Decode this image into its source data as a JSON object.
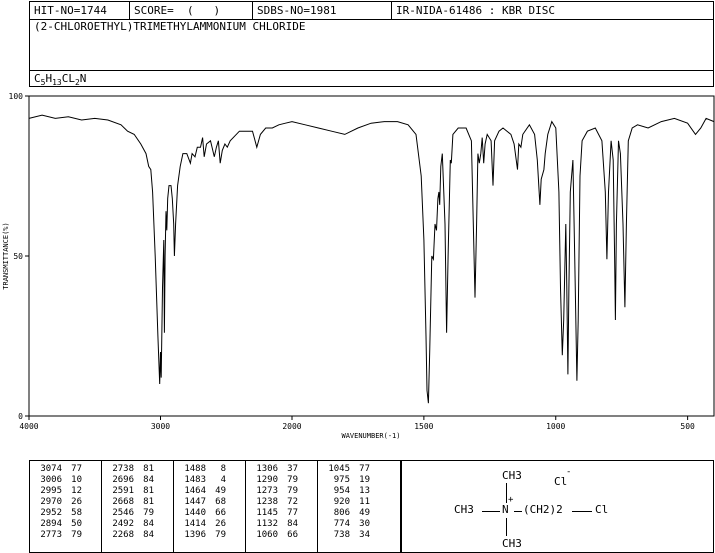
{
  "header": {
    "hit_no": "HIT-NO=1744",
    "score": "SCORE=  (   )",
    "sdbs_no": "SDBS-NO=1981",
    "ir_id": "IR-NIDA-61486 : KBR DISC",
    "compound_name": "(2-CHLOROETHYL)TRIMETHYLAMMONIUM CHLORIDE",
    "formula_parts": {
      "c": "C",
      "c_n": "5",
      "h": "H",
      "h_n": "13",
      "cl": "CL",
      "cl_n": "2",
      "n": "N"
    }
  },
  "chart_data": {
    "type": "line",
    "xlabel": "WAVENUMBER(-1)",
    "ylabel": "TRANSMITTANCE(%)",
    "xlim": [
      4000,
      400
    ],
    "ylim": [
      0,
      100
    ],
    "x_ticks": [
      4000,
      3000,
      2000,
      1500,
      1000,
      500
    ],
    "x_tick_labels": [
      "4000",
      "3000",
      "2000",
      "1500",
      "1000",
      "500"
    ],
    "y_ticks": [
      0,
      50,
      100
    ],
    "y_tick_labels": [
      "0",
      "50",
      "100"
    ],
    "series": [
      {
        "points": [
          [
            4000,
            93
          ],
          [
            3900,
            94
          ],
          [
            3800,
            93
          ],
          [
            3700,
            93.5
          ],
          [
            3600,
            92.5
          ],
          [
            3500,
            93
          ],
          [
            3400,
            92.5
          ],
          [
            3300,
            91
          ],
          [
            3250,
            89
          ],
          [
            3200,
            88
          ],
          [
            3150,
            85
          ],
          [
            3110,
            82
          ],
          [
            3090,
            78
          ],
          [
            3074,
            77
          ],
          [
            3060,
            70
          ],
          [
            3040,
            50
          ],
          [
            3020,
            25
          ],
          [
            3006,
            10
          ],
          [
            3000,
            20
          ],
          [
            2995,
            12
          ],
          [
            2985,
            40
          ],
          [
            2975,
            55
          ],
          [
            2970,
            26
          ],
          [
            2965,
            50
          ],
          [
            2958,
            64
          ],
          [
            2952,
            58
          ],
          [
            2945,
            68
          ],
          [
            2935,
            72
          ],
          [
            2920,
            72
          ],
          [
            2910,
            68
          ],
          [
            2900,
            60
          ],
          [
            2894,
            50
          ],
          [
            2885,
            60
          ],
          [
            2870,
            72
          ],
          [
            2850,
            78
          ],
          [
            2830,
            82
          ],
          [
            2800,
            82
          ],
          [
            2773,
            79
          ],
          [
            2760,
            82
          ],
          [
            2738,
            81
          ],
          [
            2720,
            84
          ],
          [
            2696,
            84
          ],
          [
            2680,
            87
          ],
          [
            2668,
            81
          ],
          [
            2650,
            85
          ],
          [
            2620,
            86
          ],
          [
            2591,
            81
          ],
          [
            2575,
            84
          ],
          [
            2560,
            86
          ],
          [
            2546,
            79
          ],
          [
            2530,
            83
          ],
          [
            2510,
            85
          ],
          [
            2492,
            84
          ],
          [
            2470,
            86
          ],
          [
            2400,
            89
          ],
          [
            2300,
            89
          ],
          [
            2268,
            84
          ],
          [
            2240,
            88
          ],
          [
            2200,
            90
          ],
          [
            2150,
            90
          ],
          [
            2100,
            91
          ],
          [
            2050,
            91.5
          ],
          [
            2000,
            92
          ],
          [
            1950,
            91
          ],
          [
            1900,
            90
          ],
          [
            1850,
            89
          ],
          [
            1800,
            88
          ],
          [
            1750,
            90
          ],
          [
            1700,
            91.5
          ],
          [
            1650,
            92
          ],
          [
            1600,
            92
          ],
          [
            1560,
            91
          ],
          [
            1530,
            88
          ],
          [
            1510,
            75
          ],
          [
            1500,
            55
          ],
          [
            1492,
            25
          ],
          [
            1488,
            8
          ],
          [
            1483,
            4
          ],
          [
            1478,
            20
          ],
          [
            1470,
            50
          ],
          [
            1464,
            49
          ],
          [
            1458,
            60
          ],
          [
            1452,
            58
          ],
          [
            1447,
            68
          ],
          [
            1443,
            70
          ],
          [
            1440,
            66
          ],
          [
            1436,
            78
          ],
          [
            1430,
            82
          ],
          [
            1420,
            60
          ],
          [
            1414,
            26
          ],
          [
            1408,
            50
          ],
          [
            1400,
            80
          ],
          [
            1396,
            79
          ],
          [
            1390,
            88
          ],
          [
            1370,
            90
          ],
          [
            1340,
            90
          ],
          [
            1320,
            86
          ],
          [
            1306,
            37
          ],
          [
            1300,
            60
          ],
          [
            1295,
            82
          ],
          [
            1290,
            79
          ],
          [
            1284,
            82
          ],
          [
            1279,
            87
          ],
          [
            1273,
            79
          ],
          [
            1268,
            85
          ],
          [
            1260,
            88
          ],
          [
            1245,
            86
          ],
          [
            1238,
            72
          ],
          [
            1232,
            86
          ],
          [
            1215,
            89
          ],
          [
            1200,
            90
          ],
          [
            1170,
            88
          ],
          [
            1158,
            85
          ],
          [
            1145,
            77
          ],
          [
            1140,
            85
          ],
          [
            1132,
            84
          ],
          [
            1125,
            88
          ],
          [
            1100,
            91
          ],
          [
            1080,
            88
          ],
          [
            1070,
            80
          ],
          [
            1060,
            66
          ],
          [
            1055,
            74
          ],
          [
            1045,
            77
          ],
          [
            1040,
            82
          ],
          [
            1030,
            88
          ],
          [
            1015,
            92
          ],
          [
            1000,
            90
          ],
          [
            988,
            70
          ],
          [
            982,
            40
          ],
          [
            975,
            19
          ],
          [
            970,
            30
          ],
          [
            962,
            60
          ],
          [
            958,
            40
          ],
          [
            954,
            13
          ],
          [
            950,
            40
          ],
          [
            945,
            70
          ],
          [
            935,
            80
          ],
          [
            928,
            50
          ],
          [
            920,
            11
          ],
          [
            915,
            30
          ],
          [
            908,
            75
          ],
          [
            900,
            86
          ],
          [
            880,
            89
          ],
          [
            850,
            90
          ],
          [
            825,
            86
          ],
          [
            812,
            70
          ],
          [
            806,
            49
          ],
          [
            800,
            70
          ],
          [
            790,
            86
          ],
          [
            782,
            80
          ],
          [
            777,
            50
          ],
          [
            774,
            30
          ],
          [
            770,
            60
          ],
          [
            762,
            86
          ],
          [
            755,
            82
          ],
          [
            745,
            60
          ],
          [
            738,
            34
          ],
          [
            732,
            60
          ],
          [
            725,
            86
          ],
          [
            710,
            90
          ],
          [
            690,
            91
          ],
          [
            650,
            90
          ],
          [
            600,
            92
          ],
          [
            550,
            93
          ],
          [
            500,
            91.5
          ],
          [
            470,
            88
          ],
          [
            450,
            90
          ],
          [
            430,
            93
          ],
          [
            400,
            92
          ]
        ]
      }
    ]
  },
  "peaks": {
    "columns": [
      [
        [
          "3074",
          "77"
        ],
        [
          "3006",
          "10"
        ],
        [
          "2995",
          "12"
        ],
        [
          "2970",
          "26"
        ],
        [
          "2952",
          "58"
        ],
        [
          "2894",
          "50"
        ],
        [
          "2773",
          "79"
        ]
      ],
      [
        [
          "2738",
          "81"
        ],
        [
          "2696",
          "84"
        ],
        [
          "2591",
          "81"
        ],
        [
          "2668",
          "81"
        ],
        [
          "2546",
          "79"
        ],
        [
          "2492",
          "84"
        ],
        [
          "2268",
          "84"
        ]
      ],
      [
        [
          "1488",
          "8"
        ],
        [
          "1483",
          "4"
        ],
        [
          "1464",
          "49"
        ],
        [
          "1447",
          "68"
        ],
        [
          "1440",
          "66"
        ],
        [
          "1414",
          "26"
        ],
        [
          "1396",
          "79"
        ]
      ],
      [
        [
          "1306",
          "37"
        ],
        [
          "1290",
          "79"
        ],
        [
          "1273",
          "79"
        ],
        [
          "1238",
          "72"
        ],
        [
          "1145",
          "77"
        ],
        [
          "1132",
          "84"
        ],
        [
          "1060",
          "66"
        ]
      ],
      [
        [
          "1045",
          "77"
        ],
        [
          "975",
          "19"
        ],
        [
          "954",
          "13"
        ],
        [
          "920",
          "11"
        ],
        [
          "806",
          "49"
        ],
        [
          "774",
          "30"
        ],
        [
          "738",
          "34"
        ]
      ]
    ]
  },
  "structure": {
    "top_methyl": "CH3",
    "chloride_ion": "Cl",
    "left_methyl": "CH3",
    "nitrogen": "N",
    "plus": "+",
    "chain": "(CH2)2",
    "chain_cl": "Cl",
    "bottom_methyl": "CH3",
    "minus": "-"
  }
}
